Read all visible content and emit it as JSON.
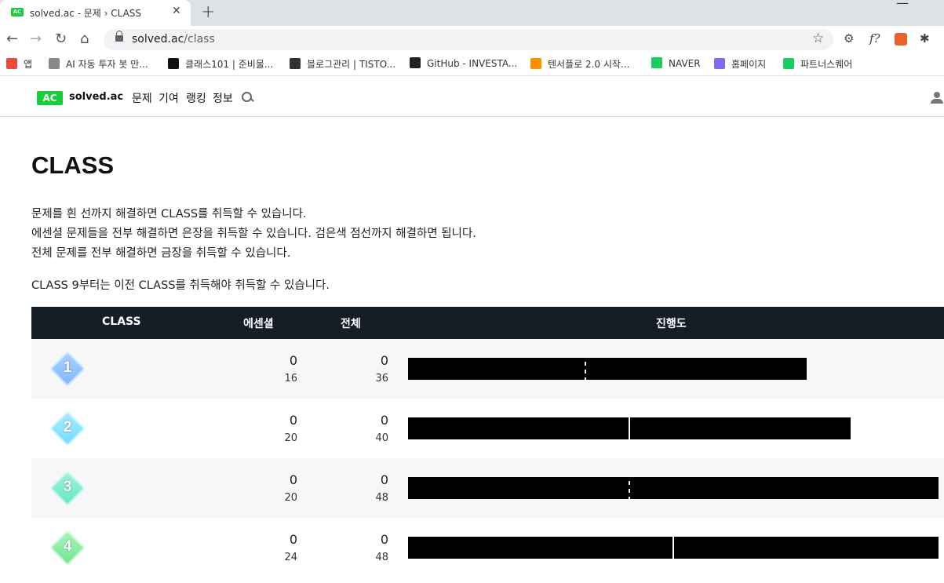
{
  "browser": {
    "tab_title": "solved.ac - 문제 › CLASS",
    "tab_favicon": "AC",
    "url_host": "solved.ac",
    "url_path": "/class",
    "bookmarks": [
      {
        "label": "앱",
        "icon": "apps-grid-icon",
        "color": "#e74c3c"
      },
      {
        "label": "AI 자동 투자 봇 만...",
        "icon": "wiki-icon",
        "color": "#888888"
      },
      {
        "label": "클래스101 | 준비물...",
        "icon": "class101-icon",
        "color": "#111111"
      },
      {
        "label": "블로그관리 | TISTO...",
        "icon": "tistory-icon",
        "color": "#333333"
      },
      {
        "label": "GitHub - INVESTA...",
        "icon": "github-icon",
        "color": "#222222"
      },
      {
        "label": "텐서플로 2.0 시작...",
        "icon": "tensorflow-icon",
        "color": "#ff8f00"
      },
      {
        "label": "NAVER",
        "icon": "naver-icon",
        "color": "#19ce60"
      },
      {
        "label": "홈페이지",
        "icon": "homepage-icon",
        "color": "#7b6cf0"
      },
      {
        "label": "파트너스퀘어",
        "icon": "partnersquare-icon",
        "color": "#19ce60"
      }
    ]
  },
  "site": {
    "logo_badge": "AC",
    "logo_text": "solved.ac",
    "menu": [
      "문제",
      "기여",
      "랭킹",
      "정보"
    ]
  },
  "main": {
    "title": "CLASS",
    "desc_lines": [
      "문제를 흰 선까지 해결하면 CLASS를 취득할 수 있습니다.",
      "에센셜 문제들을 전부 해결하면 은장을 취득할 수 있습니다. 검은색 점선까지 해결하면 됩니다.",
      "전체 문제를 전부 해결하면 금장을 취득할 수 있습니다."
    ],
    "note": "CLASS 9부터는 이전 CLASS를 취득해야 취득할 수 있습니다.",
    "table": {
      "headers": [
        "CLASS",
        "에센셜",
        "전체",
        "진행도"
      ],
      "rows": [
        {
          "class": "1",
          "ess_solved": "0",
          "ess_total": "16",
          "tot_solved": "0",
          "tot_total": "36",
          "colors": [
            "#7fb8ff",
            "#a9d4ff"
          ]
        },
        {
          "class": "2",
          "ess_solved": "0",
          "ess_total": "20",
          "tot_solved": "0",
          "tot_total": "40",
          "colors": [
            "#6fdcff",
            "#b0ecff"
          ]
        },
        {
          "class": "3",
          "ess_solved": "0",
          "ess_total": "20",
          "tot_solved": "0",
          "tot_total": "48",
          "colors": [
            "#5fe8c4",
            "#a8f3dd"
          ]
        },
        {
          "class": "4",
          "ess_solved": "0",
          "ess_total": "24",
          "tot_solved": "0",
          "tot_total": "48",
          "colors": [
            "#6ee88b",
            "#aef5bd"
          ]
        }
      ]
    }
  }
}
